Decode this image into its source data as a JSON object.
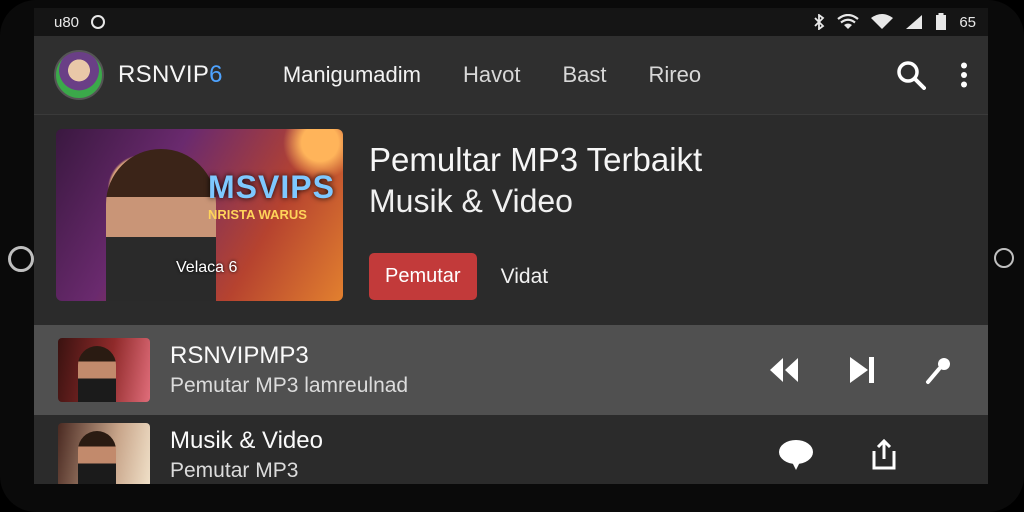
{
  "status_bar": {
    "time": "u80",
    "battery": "65"
  },
  "app": {
    "title_main": "RSNVIP",
    "title_suffix": "6"
  },
  "nav": {
    "items": [
      {
        "label": "Manigumadim"
      },
      {
        "label": "Havot"
      },
      {
        "label": "Bast"
      },
      {
        "label": "Rireo"
      }
    ]
  },
  "hero": {
    "image_logo": "MSVIPS",
    "image_logo_sub": "NRISTA WARUS",
    "image_caption": "Velaca 6",
    "title": "Pemultar MP3 Terbaikt",
    "subtitle": "Musik & Video",
    "primary_label": "Pemutar",
    "secondary_label": "Vidat"
  },
  "list": [
    {
      "title": "RSNVIPMP3",
      "subtitle": "Pemutar MP3 lamreulnad"
    },
    {
      "title": "Musik & Video",
      "subtitle": "Pemutar MP3"
    }
  ],
  "icons": {
    "search": "search-icon",
    "more": "more-vert-icon",
    "rewind": "rewind-icon",
    "skip_next": "skip-next-icon",
    "microphone": "microphone-icon",
    "chat": "chat-bubble-icon",
    "share": "share-icon"
  },
  "colors": {
    "accent": "#c23a3a",
    "brand_digit": "#4ea3ff",
    "background": "#2a2a2a",
    "selected_row": "#505050"
  }
}
